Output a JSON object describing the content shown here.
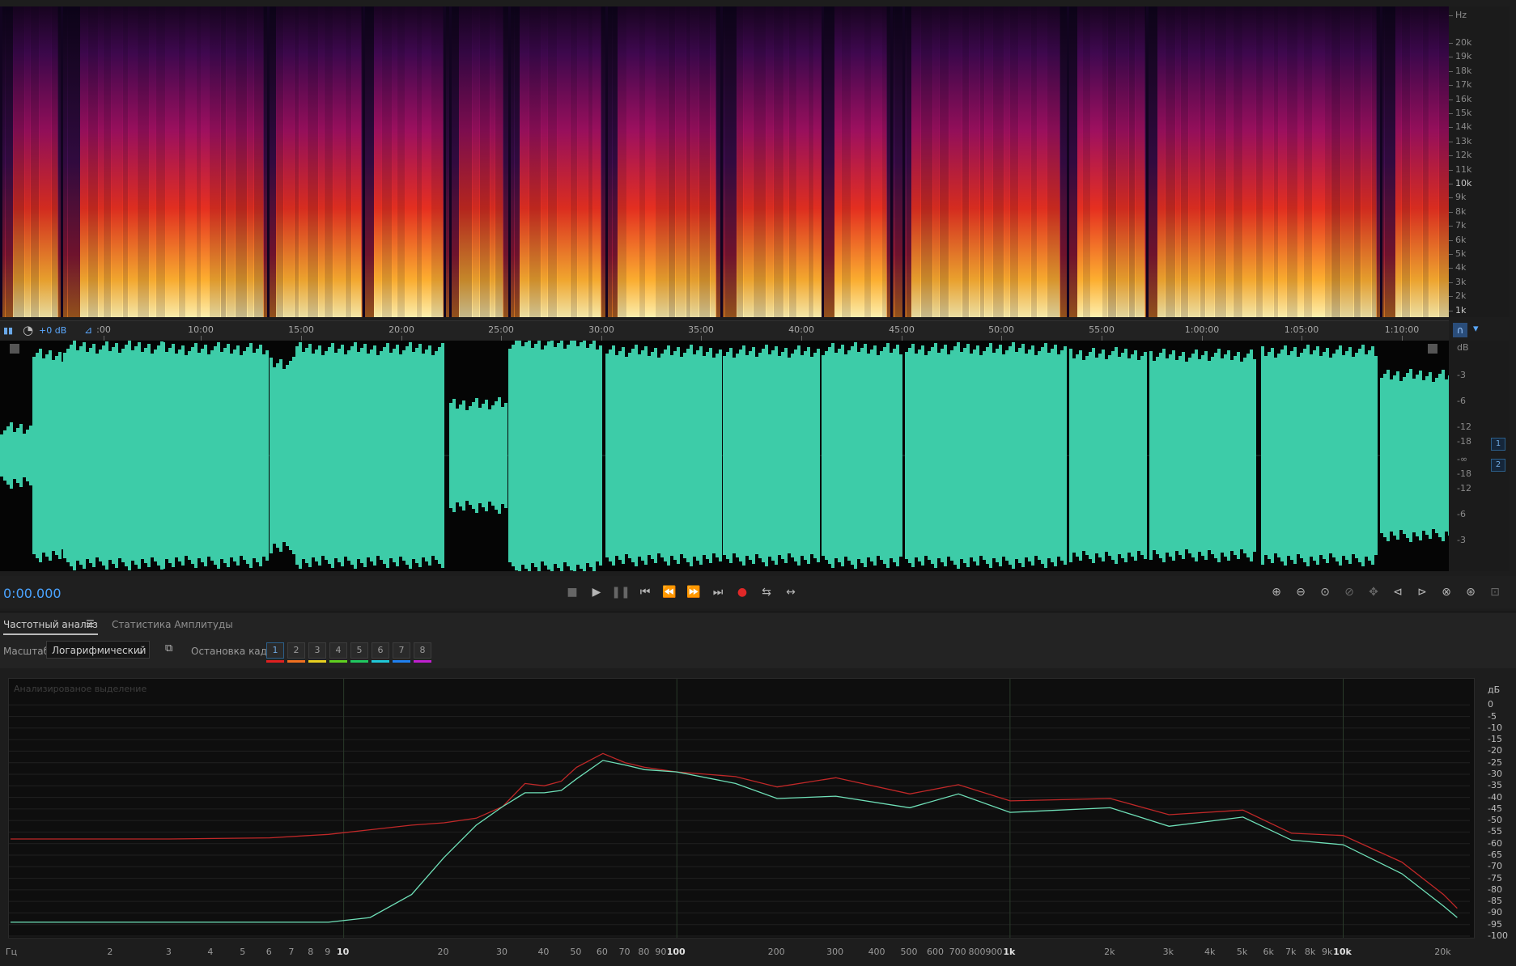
{
  "spectrogram": {
    "hz_unit": "Hz",
    "hz_ticks": [
      "20k",
      "19k",
      "18k",
      "17k",
      "16k",
      "15k",
      "14k",
      "13k",
      "12k",
      "11k",
      "10k",
      "9k",
      "8k",
      "7k",
      "6k",
      "5k",
      "4k",
      "3k",
      "2k",
      "1k"
    ]
  },
  "timeline": {
    "gain": "+0 dB",
    "ticks": [
      ":00",
      "10:00",
      "15:00",
      "20:00",
      "25:00",
      "30:00",
      "35:00",
      "40:00",
      "45:00",
      "50:00",
      "55:00",
      "1:00:00",
      "1:05:00",
      "1:10:00"
    ]
  },
  "waveform": {
    "db_unit": "dB",
    "db_ticks_top": [
      "-3",
      "-6",
      "-12",
      "-18",
      "-∞"
    ],
    "db_ticks_bottom": [
      "-18",
      "-12",
      "-6",
      "-3"
    ],
    "channels": [
      "1",
      "2"
    ],
    "color": "#3dcca8"
  },
  "transport": {
    "time": "0:00.000",
    "buttons": [
      "stop",
      "play",
      "pause",
      "go-to-start",
      "rewind",
      "fast-forward",
      "go-to-end",
      "record",
      "loop",
      "skip-selection"
    ]
  },
  "panel": {
    "tabs": [
      "Частотный анализ",
      "Статистика Амплитуды"
    ],
    "scale_label": "Масштаб:",
    "scale_value": "Логарифмический",
    "frame_label": "Остановка кадра:",
    "frames": [
      {
        "n": "1",
        "color": "#e02020"
      },
      {
        "n": "2",
        "color": "#f07020"
      },
      {
        "n": "3",
        "color": "#e8d020"
      },
      {
        "n": "4",
        "color": "#60d020"
      },
      {
        "n": "5",
        "color": "#20c860"
      },
      {
        "n": "6",
        "color": "#20c8d8"
      },
      {
        "n": "7",
        "color": "#2080f0"
      },
      {
        "n": "8",
        "color": "#c020d0"
      }
    ]
  },
  "chart_data": {
    "type": "line",
    "title": "Анализированое выделение",
    "xlabel": "Гц",
    "ylabel": "дБ",
    "x_scale": "log",
    "xlim": [
      1,
      24000
    ],
    "ylim": [
      -100,
      5
    ],
    "x_ticks": [
      "2",
      "3",
      "4",
      "5",
      "6",
      "7",
      "8",
      "9",
      "10",
      "20",
      "30",
      "40",
      "50",
      "60",
      "70",
      "80",
      "90",
      "100",
      "200",
      "300",
      "400",
      "500",
      "600",
      "700",
      "800",
      "900",
      "1k",
      "2k",
      "3k",
      "4k",
      "5k",
      "6k",
      "7k",
      "8k",
      "9k",
      "10k",
      "20k"
    ],
    "y_ticks": [
      "дБ",
      "0",
      "-5",
      "-10",
      "-15",
      "-20",
      "-25",
      "-30",
      "-35",
      "-40",
      "-45",
      "-50",
      "-55",
      "-60",
      "-65",
      "-70",
      "-75",
      "-80",
      "-85",
      "-90",
      "-95",
      "-100"
    ],
    "series": [
      {
        "color": "#c02828",
        "x": [
          1,
          3,
          6,
          9,
          12,
          16,
          20,
          25,
          30,
          35,
          40,
          45,
          50,
          60,
          70,
          80,
          100,
          150,
          200,
          300,
          500,
          700,
          1000,
          2000,
          3000,
          5000,
          7000,
          10000,
          15000,
          20000,
          22000
        ],
        "y": [
          -58,
          -58,
          -57.5,
          -56,
          -54,
          -52,
          -51,
          -49,
          -44,
          -34,
          -35,
          -33,
          -27,
          -21,
          -25,
          -27,
          -29,
          -31,
          -33,
          -34,
          -36,
          -37,
          -39,
          -43,
          -45,
          -48,
          -53,
          -59,
          -68,
          -82,
          -88
        ]
      },
      {
        "color": "#6fe0b8",
        "x": [
          1,
          3,
          6,
          9,
          12,
          16,
          20,
          25,
          30,
          35,
          40,
          45,
          50,
          60,
          70,
          80,
          100,
          150,
          200,
          300,
          500,
          700,
          1000,
          2000,
          3000,
          5000,
          7000,
          10000,
          15000,
          20000,
          22000
        ],
        "y": [
          -94,
          -94,
          -94,
          -94,
          -92,
          -82,
          -66,
          -52,
          -44,
          -38,
          -38,
          -37,
          -32,
          -24,
          -26,
          -28,
          -29,
          -34,
          -38,
          -42,
          -42,
          -41,
          -44,
          -47,
          -50,
          -51,
          -56,
          -63,
          -73,
          -87,
          -92
        ]
      }
    ]
  }
}
